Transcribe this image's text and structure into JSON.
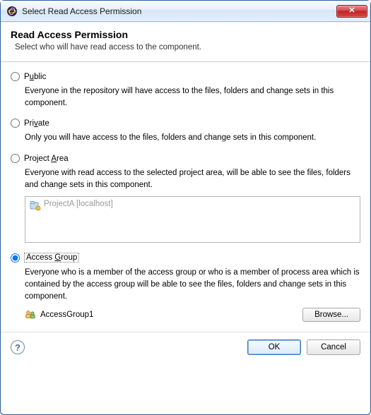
{
  "window": {
    "title": "Select Read Access Permission"
  },
  "banner": {
    "heading": "Read Access Permission",
    "subheading": "Select who will have read access to the component."
  },
  "options": {
    "public": {
      "label_pre": "P",
      "label_u": "u",
      "label_post": "blic",
      "description": "Everyone in the repository will have access to the files, folders and change sets in this component."
    },
    "private": {
      "label_pre": "Pri",
      "label_u": "v",
      "label_post": "ate",
      "description": "Only you will have access to the files, folders and change sets in this component."
    },
    "project_area": {
      "label_pre": "Project ",
      "label_u": "A",
      "label_post": "rea",
      "description": "Everyone with read access to the selected project area, will be able to see the files, folders and change sets in this component.",
      "item": "ProjectA [localhost]"
    },
    "access_group": {
      "label_pre": "Access ",
      "label_u": "G",
      "label_post": "roup",
      "description": "Everyone who is a member of the access group or who is a member of process area which is contained by the access group will be able to see the files, folders and change sets in this component.",
      "selected": "AccessGroup1",
      "browse_label": "Browse..."
    }
  },
  "selected_option": "access_group",
  "footer": {
    "ok": "OK",
    "cancel": "Cancel"
  }
}
